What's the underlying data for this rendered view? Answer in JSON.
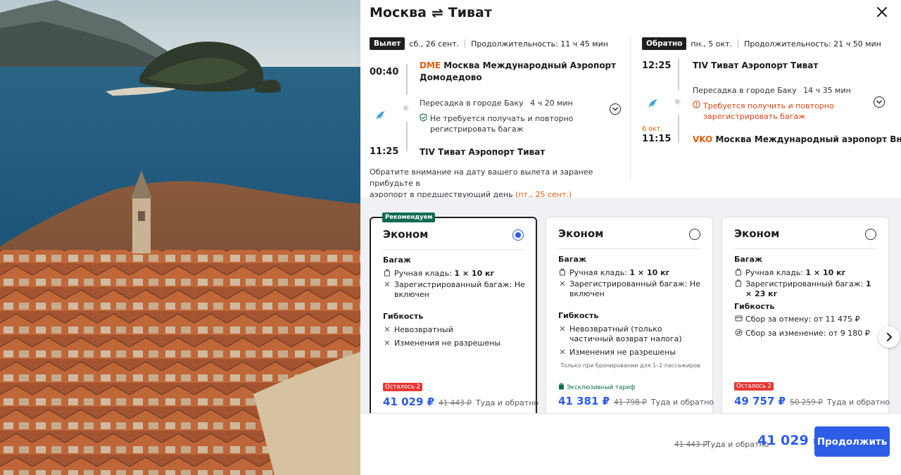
{
  "route": {
    "from": "Москва",
    "arrows": "⇌",
    "to": "Тиват"
  },
  "outbound": {
    "tag": "Вылет",
    "date": "сб., 26 сент.",
    "duration": "Продолжительность: 11 ч 45 мин",
    "dep_time": "00:40",
    "dep_code": "DME",
    "dep_airport_line1": "Москва Международный Аэропорт",
    "dep_airport_line2": "Домодедово",
    "transfer": "Пересадка в городе Баку",
    "transfer_duration": "4 ч 20 мин",
    "bag_line1": "Не требуется получать и повторно",
    "bag_line2": "регистрировать багаж",
    "arr_time": "11:25",
    "arr_code": "TIV",
    "arr_airport": "Тиват Аэропорт Тиват",
    "notice_line1": "Обратите внимание на дату вашего вылета и заранее прибудьте в",
    "notice_line2": "аэропорт в предшествующий день",
    "notice_date": "(пт., 25 сент.)"
  },
  "return": {
    "tag": "Обратно",
    "date": "пн., 5 окт.",
    "duration": "Продолжительность: 21 ч 50 мин",
    "dep_time": "12:25",
    "dep_code": "TIV",
    "dep_airport": "Тиват Аэропорт Тиват",
    "transfer": "Пересадка в городе Баку",
    "transfer_duration": "14 ч 35 мин",
    "bag_line1": "Требуется получить и повторно",
    "bag_line2": "зарегистрировать багаж",
    "arr_date": "6 окт.",
    "arr_time": "11:15",
    "arr_code": "VKO",
    "arr_airport": "Москва Международный аэропорт Внуково А"
  },
  "tariffs": [
    {
      "badge": "Рекомендуем",
      "name": "Эконом",
      "selected": true,
      "baggage_title": "Багаж",
      "carry_on_label": "Ручная кладь:",
      "carry_on_value": "1 × 10 кг",
      "checked_label": "Зарегистрированный багаж:",
      "checked_value": "Не включен",
      "flex_title": "Гибкость",
      "flex1": "Невозвратный",
      "flex2": "Изменения не разрешены",
      "left_badge": "Осталось 2",
      "price": "41 029 ₽",
      "old_price": "41 443 ₽",
      "price_note": "Туда и обратно"
    },
    {
      "name": "Эконом",
      "selected": false,
      "baggage_title": "Багаж",
      "carry_on_label": "Ручная кладь:",
      "carry_on_value": "1 × 10 кг",
      "checked_label": "Зарегистрированный багаж:",
      "checked_value": "Не включен",
      "flex_title": "Гибкость",
      "flex1": "Невозвратный (только частичный возврат налога)",
      "flex2": "Изменения не разрешены",
      "fine_print": "Только при бронировании для 1–2 пассажиров",
      "excl_badge": "Эксклюзивный тариф",
      "price": "41 381 ₽",
      "old_price": "41 798 ₽",
      "price_note": "Туда и обратно"
    },
    {
      "name": "Эконом",
      "selected": false,
      "baggage_title": "Багаж",
      "carry_on_label": "Ручная кладь:",
      "carry_on_value": "1 × 10 кг",
      "checked_label": "Зарегистрированный багаж:",
      "checked_value": "1 × 23 кг",
      "flex_title": "Гибкость",
      "flex1": "Сбор за отмену: от 11 475 ₽",
      "flex2": "Сбор за изменение: от 9 180 ₽",
      "left_badge": "Осталось 2",
      "price": "49 757 ₽",
      "old_price": "50 259 ₽",
      "price_note": "Туда и обратно"
    }
  ],
  "footer": {
    "old_price": "41 443 ₽",
    "note": "Туда и обратно",
    "total": "41 029 ₽",
    "continue_label": "Продолжить"
  },
  "colors": {
    "accent": "#2d5ce6",
    "code": "#e85c0d",
    "warn": "#d84315",
    "green": "#0e6b52",
    "red": "#e53935"
  },
  "icons": {
    "close": "close-icon",
    "airline": "airline-logo-icon",
    "expand": "chevron-down-icon",
    "check": "check-shield-icon",
    "warning": "warning-icon",
    "bag": "bag-icon",
    "cross": "cross-icon",
    "next": "chevron-right-icon"
  }
}
